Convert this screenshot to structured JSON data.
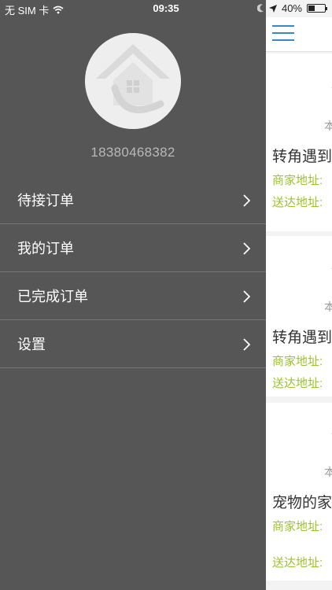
{
  "status_bar": {
    "carrier": "无 SIM 卡",
    "time": "09:35",
    "battery_text": "40%",
    "battery_level": 0.4
  },
  "drawer": {
    "phone": "18380468382",
    "menu": [
      {
        "label": "待接订单"
      },
      {
        "label": "我的订单"
      },
      {
        "label": "已完成订单"
      },
      {
        "label": "设置"
      }
    ]
  },
  "content": {
    "orders": [
      {
        "partial_mark": "本",
        "title_partial": "转角遇到",
        "merchant_label": "商家地址:",
        "delivery_label": "送达地址:"
      },
      {
        "partial_mark": "本",
        "title_partial": "转角遇到",
        "merchant_label": "商家地址:",
        "delivery_label": "送达地址:"
      },
      {
        "partial_mark": "本",
        "title_partial": "宠物的家",
        "merchant_label": "商家地址:",
        "delivery_label": "送达地址:"
      }
    ]
  },
  "colors": {
    "drawer_bg": "#565656",
    "accent_blue": "#3a86c9",
    "address_green": "#9cc32e"
  }
}
